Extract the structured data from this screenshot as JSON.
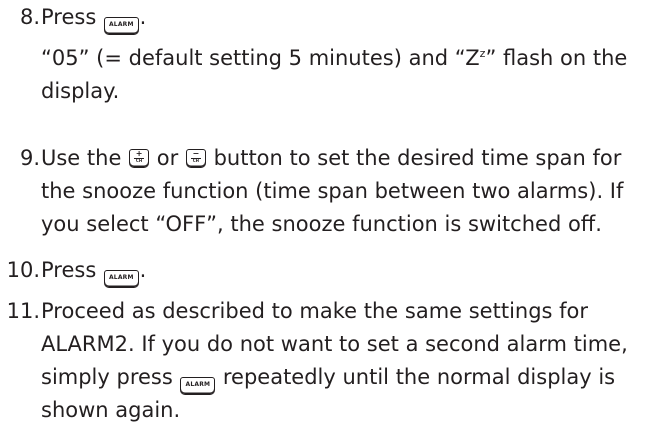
{
  "steps": [
    {
      "number": "8.",
      "text_before": "Press ",
      "button": "ALARM",
      "text_after": ".",
      "note": {
        "part1": "“05” (= default setting 5 minutes) and “Z",
        "sup": "z",
        "part2": "” flash on the",
        "part3": "display."
      }
    },
    {
      "number": "9.",
      "line1_a": "Use the ",
      "plus_button": {
        "symbol": "+",
        "sub": "CH"
      },
      "line1_b": " or ",
      "minus_button": {
        "symbol": "−",
        "sub": "CH"
      },
      "line1_c": " button to set the desired time span for",
      "line2": "the snooze function (time span between two alarms). If",
      "line3": "you select “OFF”, the snooze function is switched off."
    },
    {
      "number": "10.",
      "text_before": "Press ",
      "button": "ALARM",
      "text_after": "."
    },
    {
      "number": "11.",
      "line1": "Proceed as described to make the same settings for",
      "line2": "ALARM2. If you do not want to set a second alarm time,",
      "line3_a": "simply press ",
      "button": "ALARM",
      "line3_b": " repeatedly until the normal display is",
      "line4": "shown again."
    }
  ],
  "icons": {
    "alarm_button": "alarm-key-icon",
    "plus_ch_button": "plus-ch-key-icon",
    "minus_ch_button": "minus-ch-key-icon"
  },
  "colors": {
    "text": "#231f20",
    "background": "#ffffff"
  }
}
